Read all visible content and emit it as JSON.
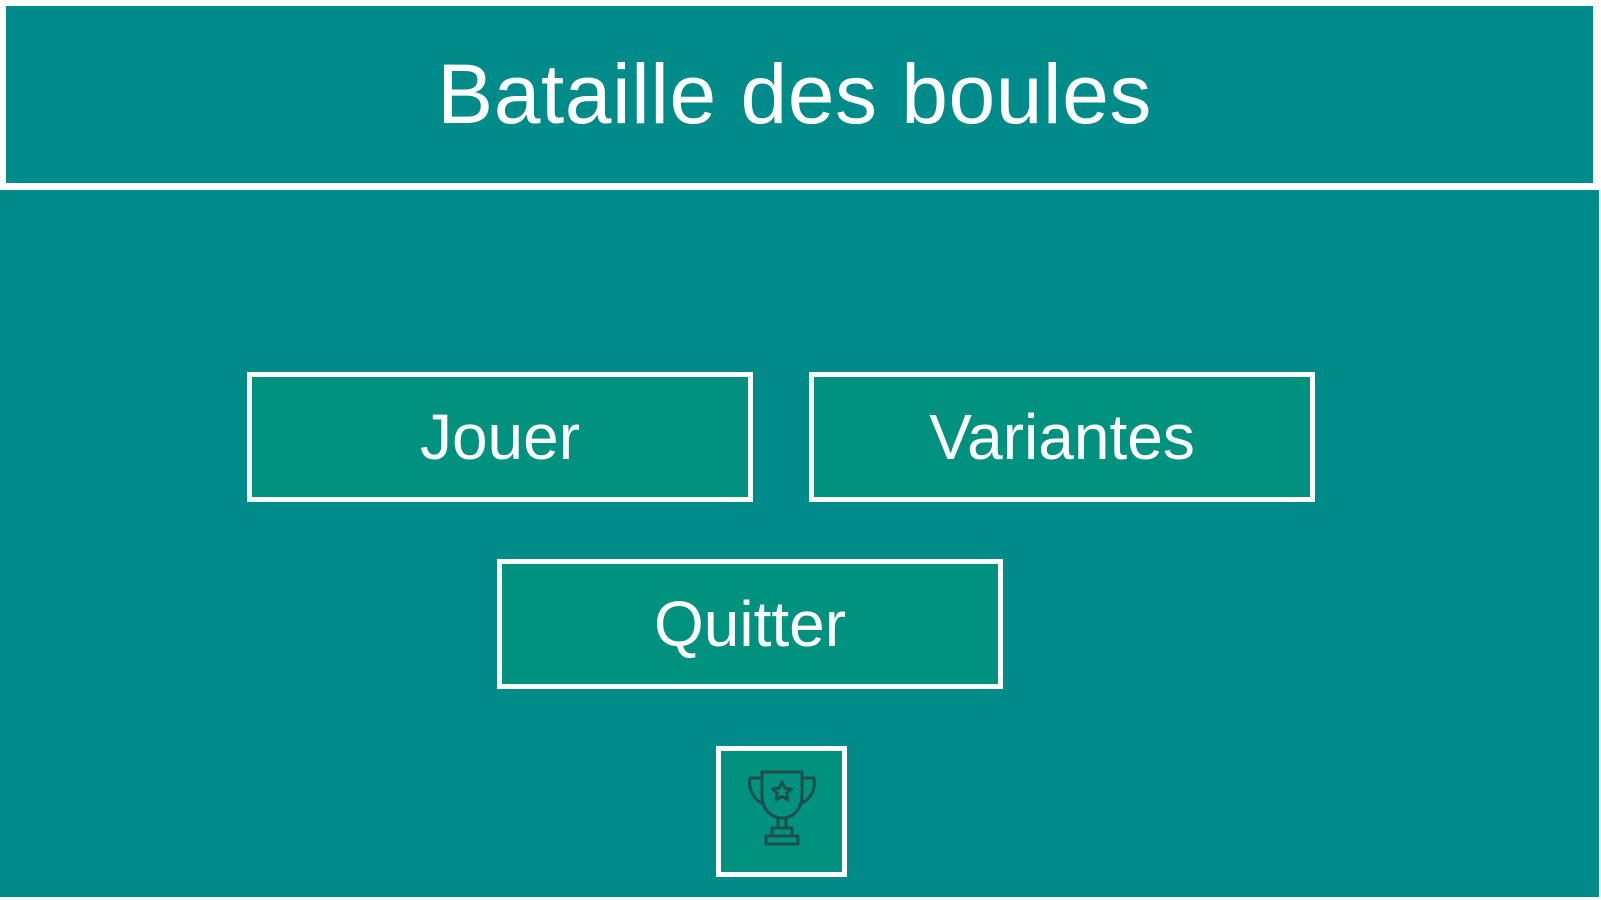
{
  "header": {
    "title": "Bataille des boules"
  },
  "menu": {
    "play_label": "Jouer",
    "variants_label": "Variantes",
    "quit_label": "Quitter",
    "leaderboard_icon": "trophy-icon"
  },
  "colors": {
    "background": "#008b8b",
    "button_fill": "#00917f",
    "border": "#ffffff",
    "text": "#ffffff",
    "icon_stroke": "#1f4f4a"
  }
}
